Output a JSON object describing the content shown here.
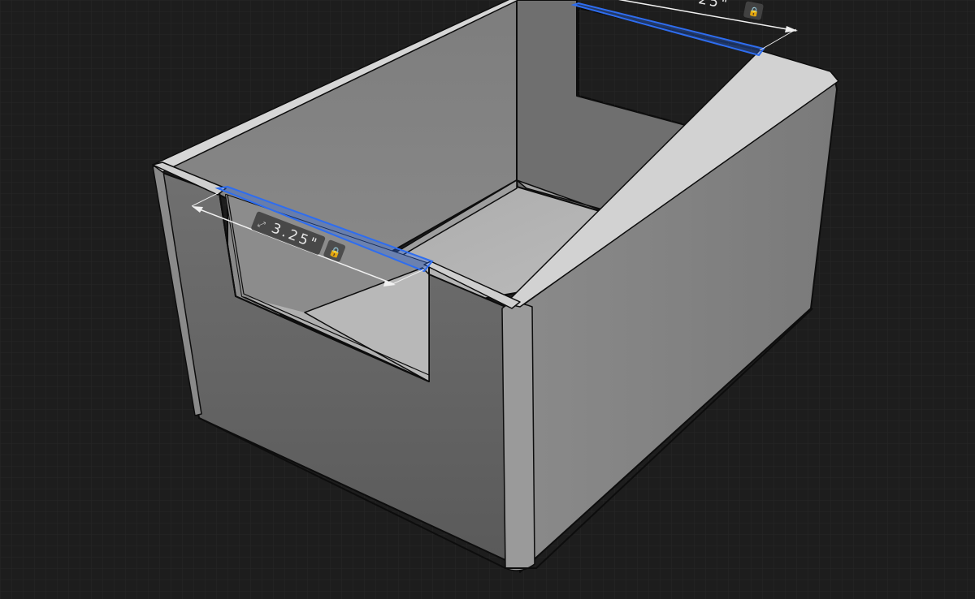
{
  "viewport": {
    "background": "#1d1d1d",
    "grid_color": "#262626",
    "model_edge_color": "#0d0d0d",
    "selection_color": "#2e6df0"
  },
  "dimensions": [
    {
      "value": "3.25\"",
      "unit": "in",
      "locked": true,
      "icon": "lock-icon",
      "prefix_icon": "resize-arrow-icon"
    },
    {
      "value": "25\"",
      "unit": "in",
      "locked": true,
      "icon": "lock-icon"
    }
  ]
}
